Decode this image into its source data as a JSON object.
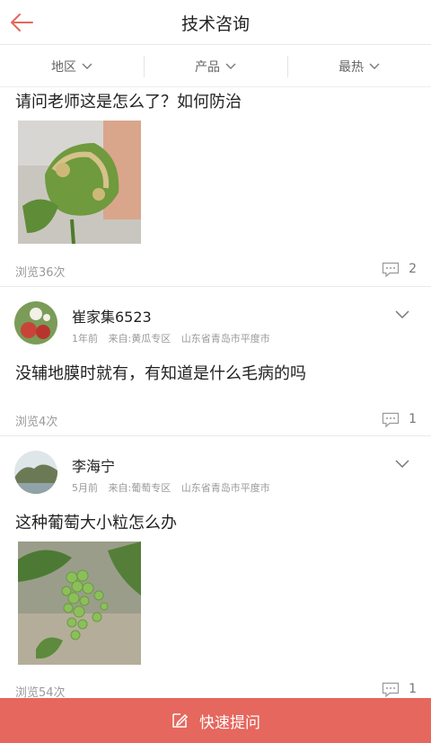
{
  "header": {
    "title": "技术咨询"
  },
  "filters": [
    {
      "label": "地区"
    },
    {
      "label": "产品"
    },
    {
      "label": "最热"
    }
  ],
  "posts": [
    {
      "question": "请问老师这是怎么了？如何防治",
      "views": "浏览36次",
      "comments": "2"
    },
    {
      "user": "崔家集6523",
      "time": "1年前",
      "source": "来自:黄瓜专区",
      "location": "山东省青岛市平度市",
      "question": "没辅地膜时就有，有知道是什么毛病的吗",
      "views": "浏览4次",
      "comments": "1"
    },
    {
      "user": "李海宁",
      "time": "5月前",
      "source": "来自:葡萄专区",
      "location": "山东省青岛市平度市",
      "question": "这种葡萄大小粒怎么办",
      "views": "浏览54次",
      "comments": "1"
    }
  ],
  "ask_button": {
    "label": "快速提问"
  },
  "colors": {
    "accent": "#e5675d",
    "back_arrow": "#e5675d"
  }
}
